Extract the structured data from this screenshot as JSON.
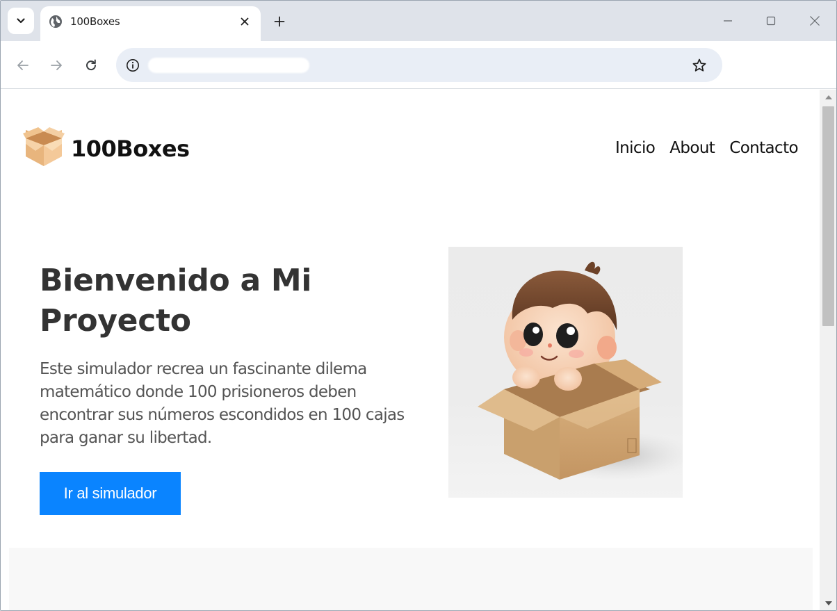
{
  "browser": {
    "tab_title": "100Boxes",
    "url": ""
  },
  "site": {
    "brand": "100Boxes",
    "nav": [
      {
        "label": "Inicio"
      },
      {
        "label": "About"
      },
      {
        "label": "Contacto"
      }
    ]
  },
  "hero": {
    "title": "Bienvenido a Mi Proyecto",
    "description": "Este simulador recrea un fascinante dilema matemático donde 100 prisioneros deben encontrar sus números escondidos en 100 cajas para ganar su libertad.",
    "cta_label": "Ir al simulador"
  },
  "colors": {
    "cta_background": "#0a84ff",
    "title_text": "#333333",
    "body_text": "#555555",
    "tabstrip": "#dfe3ea",
    "omnibox": "#e9eef6"
  },
  "icons": {
    "tab_menu": "chevron-down-icon",
    "favicon": "globe-icon",
    "tab_close": "close-icon",
    "new_tab": "plus-icon",
    "back": "arrow-left-icon",
    "forward": "arrow-right-icon",
    "reload": "reload-icon",
    "site_info": "info-icon",
    "bookmark": "star-icon",
    "logo": "box-icon"
  }
}
